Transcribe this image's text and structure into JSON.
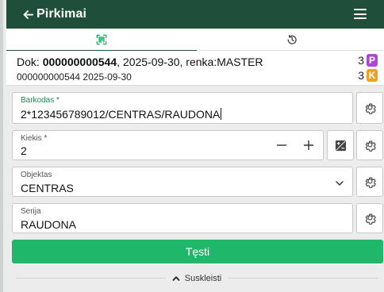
{
  "header": {
    "title": "Pirkimai",
    "back_icon": "arrow-left-icon",
    "menu_icon": "hamburger-menu-icon",
    "bg_color": "#1f4f3a"
  },
  "tabs": [
    {
      "icon": "barcode-scan-icon",
      "active": true
    },
    {
      "icon": "history-icon",
      "active": false
    }
  ],
  "document": {
    "prefix": "Dok: ",
    "number": "000000000544",
    "suffix": ", 2025-09-30, renka:MASTER",
    "line2": "000000000544 2025-09-30",
    "badges": [
      {
        "count": "3",
        "letter": "P",
        "color": "#b046d8"
      },
      {
        "count": "3",
        "letter": "K",
        "color": "#f0a020"
      }
    ]
  },
  "form": {
    "barcode": {
      "label": "Barkodas *",
      "value": "2*123456789012/CENTRAS/RAUDONA"
    },
    "quantity": {
      "label": "Kiekis *",
      "value": "2"
    },
    "object": {
      "label": "Objektas",
      "value": "CENTRAS"
    },
    "series": {
      "label": "Serija",
      "value": "RAUDONA"
    },
    "submit_label": "Tęsti",
    "collapse_label": "Suskleisti",
    "accent_color": "#1fb86a"
  }
}
